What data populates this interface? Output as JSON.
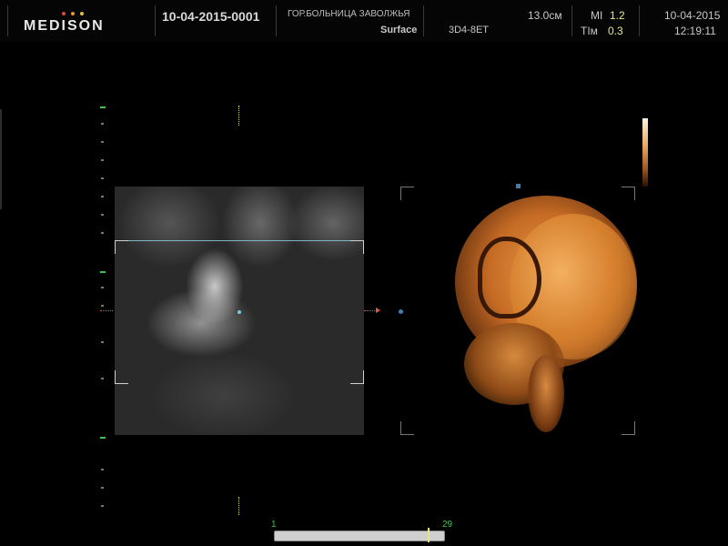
{
  "header": {
    "brand": "MEDISON",
    "patient_id": "10-04-2015-0001",
    "hospital": "ГОР.БОЛЬНИЦА ЗАВОЛЖЬЯ",
    "mode": "Surface",
    "probe": "3D4-8ET",
    "depth": "13.0см",
    "mi_label": "MI",
    "mi_value": "1.2",
    "ti_label": "TIм",
    "ti_value": "0.3",
    "date": "10-04-2015",
    "time": "12:19:11"
  },
  "colors": {
    "logo_dot_1": "#d94a3a",
    "logo_dot_2": "#e89a2a",
    "logo_dot_3": "#e0c040",
    "accent_green": "#3ec44a",
    "accent_yellow": "#e6e87a"
  },
  "frame_slider": {
    "start": "1",
    "end": "29"
  }
}
